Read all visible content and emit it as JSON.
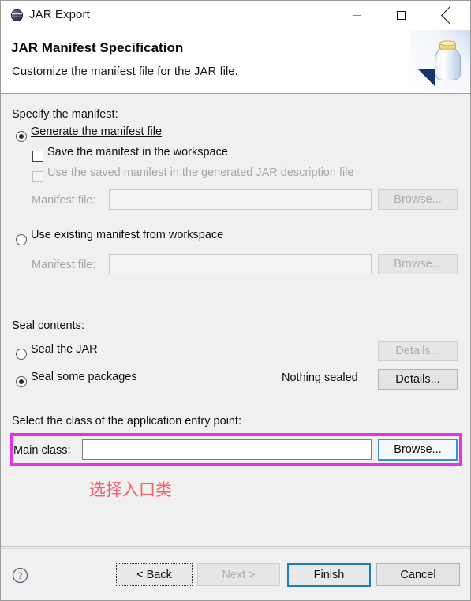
{
  "window": {
    "title": "JAR Export",
    "icon": "jar-export-icon",
    "controls": {
      "minimize": "minimize-icon",
      "maximize": "maximize-icon",
      "close": "close-icon"
    }
  },
  "header": {
    "title": "JAR Manifest Specification",
    "subtitle": "Customize the manifest file for the JAR file.",
    "banner_icon": "jar-bottle-icon"
  },
  "manifest_section": {
    "group_label": "Specify the manifest:",
    "generate_radio": {
      "label": "Generate the manifest file",
      "selected": true
    },
    "save_checkbox": {
      "label": "Save the manifest in the workspace",
      "checked": false,
      "enabled": true
    },
    "use_saved_checkbox": {
      "label": "Use the saved manifest in the generated JAR description file",
      "checked": false,
      "enabled": false
    },
    "manifest_file_1": {
      "label": "Manifest file:",
      "value": "",
      "enabled": false,
      "browse_label": "Browse..."
    },
    "existing_radio": {
      "label": "Use existing manifest from workspace",
      "selected": false
    },
    "manifest_file_2": {
      "label": "Manifest file:",
      "value": "",
      "enabled": false,
      "browse_label": "Browse..."
    }
  },
  "seal_section": {
    "group_label": "Seal contents:",
    "seal_jar_radio": {
      "label": "Seal the JAR",
      "selected": false
    },
    "seal_jar_details": {
      "label": "Details...",
      "enabled": false
    },
    "seal_packages_radio": {
      "label": "Seal some packages",
      "selected": true
    },
    "seal_status": "Nothing sealed",
    "seal_packages_details": {
      "label": "Details...",
      "enabled": true
    }
  },
  "entry_point_section": {
    "group_label": "Select the class of the application entry point:",
    "main_class_label": "Main class:",
    "main_class_value": "",
    "browse_label": "Browse...",
    "highlight_color": "#e832e8",
    "annotation": "选择入口类",
    "annotation_color": "#f4606c"
  },
  "footer": {
    "help_icon": "help-question-icon",
    "back_label": "< Back",
    "next_label": "Next >",
    "finish_label": "Finish",
    "cancel_label": "Cancel",
    "next_enabled": false,
    "finish_is_default": true
  }
}
